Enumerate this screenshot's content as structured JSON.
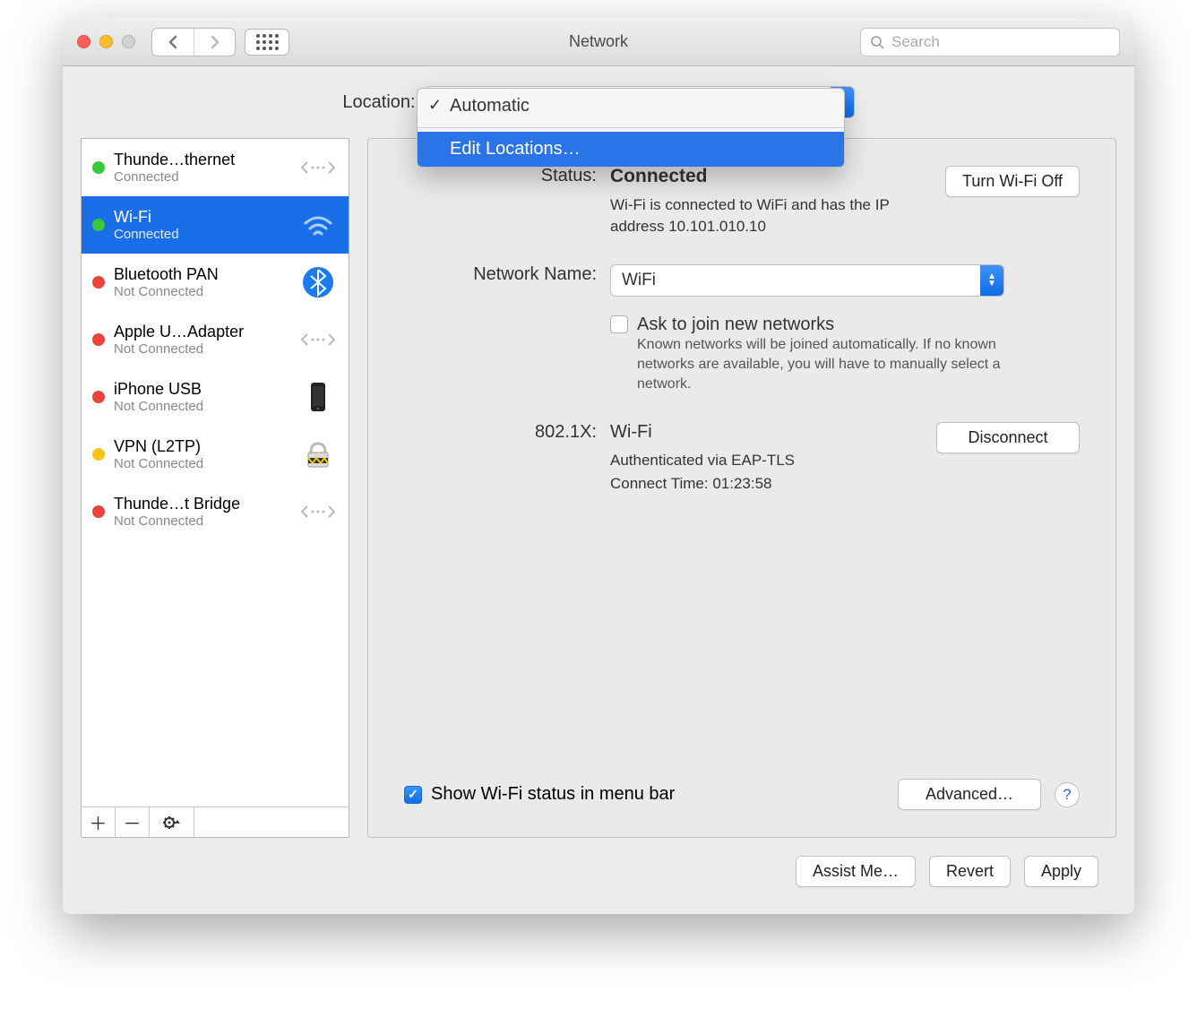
{
  "window": {
    "title": "Network"
  },
  "search": {
    "placeholder": "Search",
    "value": ""
  },
  "location": {
    "label": "Location:",
    "dropdown": {
      "selected": "Automatic",
      "items": [
        "Automatic"
      ],
      "edit_label": "Edit Locations…"
    }
  },
  "sidebar": {
    "services": [
      {
        "name": "Thunde…thernet",
        "status": "Connected",
        "dot": "green",
        "icon": "ethernet"
      },
      {
        "name": "Wi-Fi",
        "status": "Connected",
        "dot": "green",
        "icon": "wifi",
        "selected": true
      },
      {
        "name": "Bluetooth PAN",
        "status": "Not Connected",
        "dot": "red",
        "icon": "bluetooth"
      },
      {
        "name": "Apple U…Adapter",
        "status": "Not Connected",
        "dot": "red",
        "icon": "ethernet"
      },
      {
        "name": "iPhone USB",
        "status": "Not Connected",
        "dot": "red",
        "icon": "iphone"
      },
      {
        "name": "VPN (L2TP)",
        "status": "Not Connected",
        "dot": "yellow",
        "icon": "vpn"
      },
      {
        "name": "Thunde…t Bridge",
        "status": "Not Connected",
        "dot": "red",
        "icon": "ethernet"
      }
    ]
  },
  "details": {
    "status_label": "Status:",
    "status_value": "Connected",
    "status_desc": "Wi-Fi is connected to WiFi and has the IP address 10.101.010.10",
    "toggle_wifi_label": "Turn Wi-Fi Off",
    "network_name_label": "Network Name:",
    "network_name_value": "WiFi",
    "ask_join_label": "Ask to join new networks",
    "ask_join_desc": "Known networks will be joined automatically. If no known networks are available, you will have to manually select a network.",
    "dot1x_label": "802.1X:",
    "dot1x_value": "Wi-Fi",
    "dot1x_auth": "Authenticated via EAP-TLS",
    "dot1x_time": "Connect Time: 01:23:58",
    "disconnect_label": "Disconnect",
    "show_menu_label": "Show Wi-Fi status in menu bar",
    "advanced_label": "Advanced…"
  },
  "footer": {
    "assist_label": "Assist Me…",
    "revert_label": "Revert",
    "apply_label": "Apply"
  }
}
